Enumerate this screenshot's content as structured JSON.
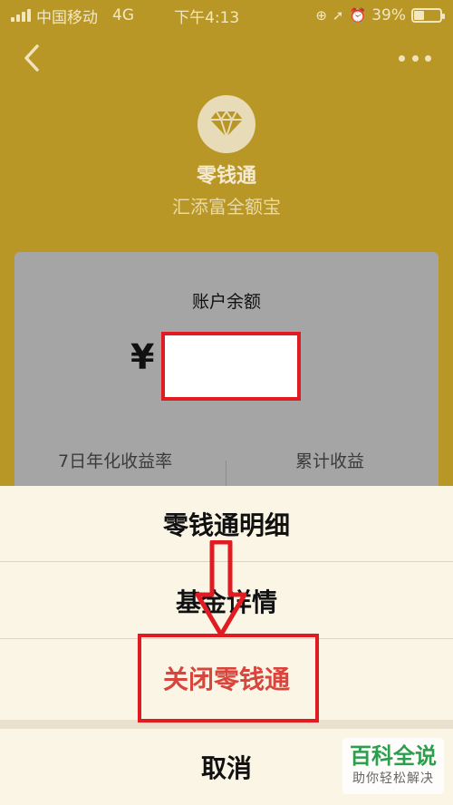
{
  "status_bar": {
    "carrier": "中国移动",
    "network": "4G",
    "time": "下午4:13",
    "battery": "39%",
    "battery_level": 0.39
  },
  "header": {
    "product_name": "零钱通",
    "provider": "汇添富全额宝"
  },
  "account": {
    "balance_label": "账户余额",
    "currency_symbol": "¥",
    "stat_left_label": "7日年化收益率",
    "stat_right_label": "累计收益"
  },
  "action_sheet": {
    "items": [
      "零钱通明细",
      "基金详情",
      "关闭零钱通"
    ],
    "cancel": "取消"
  },
  "watermark": {
    "title": "百科全说",
    "subtitle": "助你轻松解决"
  },
  "colors": {
    "background": "#b99726",
    "highlight": "#e11b22",
    "danger_text": "#d9453c"
  }
}
